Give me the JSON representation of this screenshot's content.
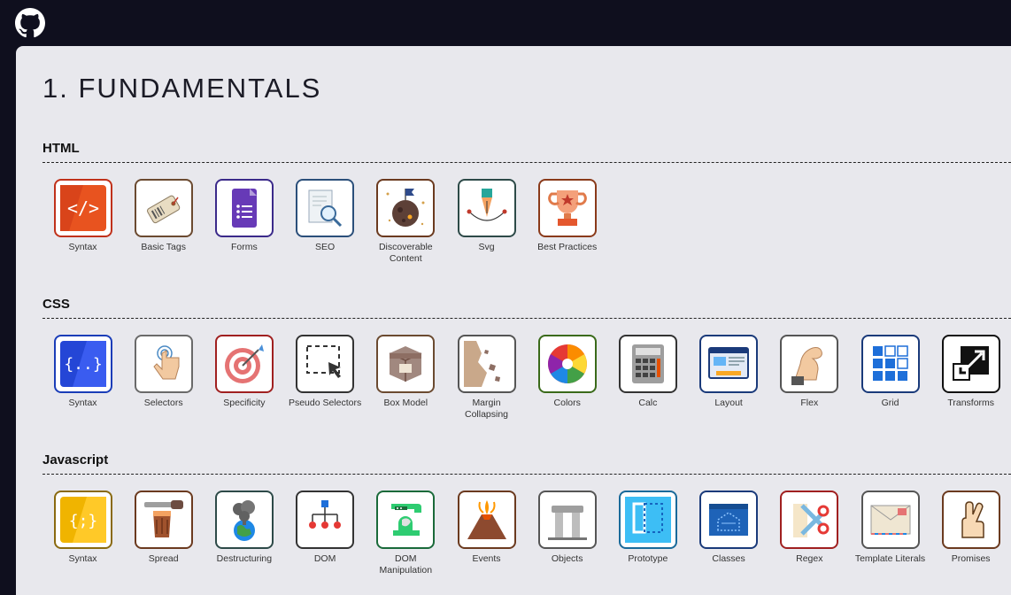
{
  "header": {
    "logo_icon": "github-icon"
  },
  "page": {
    "title": "1. FUNDAMENTALS"
  },
  "sections": [
    {
      "title": "HTML",
      "items": [
        {
          "label": "Syntax",
          "icon": "code-icon",
          "border": "#c0311a"
        },
        {
          "label": "Basic Tags",
          "icon": "tag-icon",
          "border": "#6b4a30"
        },
        {
          "label": "Forms",
          "icon": "form-icon",
          "border": "#3b2a8a"
        },
        {
          "label": "SEO",
          "icon": "search-document-icon",
          "border": "#2b4f7a"
        },
        {
          "label": "Discoverable Content",
          "icon": "planet-flag-icon",
          "border": "#6b3a1f"
        },
        {
          "label": "Svg",
          "icon": "pen-nib-icon",
          "border": "#2d4a48"
        },
        {
          "label": "Best Practices",
          "icon": "trophy-icon",
          "border": "#8a3a1a"
        }
      ]
    },
    {
      "title": "CSS",
      "items": [
        {
          "label": "Syntax",
          "icon": "css-braces-icon",
          "border": "#1a3db8"
        },
        {
          "label": "Selectors",
          "icon": "tap-hand-icon",
          "border": "#6a6a6a"
        },
        {
          "label": "Specificity",
          "icon": "target-icon",
          "border": "#a02020"
        },
        {
          "label": "Pseudo Selectors",
          "icon": "selection-cursor-icon",
          "border": "#333"
        },
        {
          "label": "Box Model",
          "icon": "box-icon",
          "border": "#6b4a30"
        },
        {
          "label": "Margin Collapsing",
          "icon": "rock-cliff-icon",
          "border": "#555"
        },
        {
          "label": "Colors",
          "icon": "color-wheel-icon",
          "border": "#3a6a1a"
        },
        {
          "label": "Calc",
          "icon": "calculator-icon",
          "border": "#333"
        },
        {
          "label": "Layout",
          "icon": "layout-icon",
          "border": "#1a3a7a"
        },
        {
          "label": "Flex",
          "icon": "flex-arm-icon",
          "border": "#555"
        },
        {
          "label": "Grid",
          "icon": "grid-icon",
          "border": "#1a3a7a"
        },
        {
          "label": "Transforms",
          "icon": "transform-arrow-icon",
          "border": "#111"
        }
      ]
    },
    {
      "title": "Javascript",
      "items": [
        {
          "label": "Syntax",
          "icon": "js-braces-icon",
          "border": "#8a6a10"
        },
        {
          "label": "Spread",
          "icon": "knife-butter-icon",
          "border": "#6b3a1f"
        },
        {
          "label": "Destructuring",
          "icon": "volcano-earth-icon",
          "border": "#2d4a48"
        },
        {
          "label": "DOM",
          "icon": "dom-tree-icon",
          "border": "#333"
        },
        {
          "label": "DOM Manipulation",
          "icon": "mixer-icon",
          "border": "#1a6a3a"
        },
        {
          "label": "Events",
          "icon": "volcano-icon",
          "border": "#6b3a1f"
        },
        {
          "label": "Objects",
          "icon": "stonehenge-icon",
          "border": "#555"
        },
        {
          "label": "Prototype",
          "icon": "prototype-icon",
          "border": "#1a6a9a"
        },
        {
          "label": "Classes",
          "icon": "blueprint-icon",
          "border": "#1a3a7a"
        },
        {
          "label": "Regex",
          "icon": "scissors-icon",
          "border": "#a02020"
        },
        {
          "label": "Template Literals",
          "icon": "envelope-icon",
          "border": "#555"
        },
        {
          "label": "Promises",
          "icon": "crossed-fingers-icon",
          "border": "#6b3a1f"
        }
      ]
    }
  ],
  "colors": {
    "background": "#0f0f1e",
    "panel": "#e8e8ed",
    "text": "#1b1b26"
  }
}
